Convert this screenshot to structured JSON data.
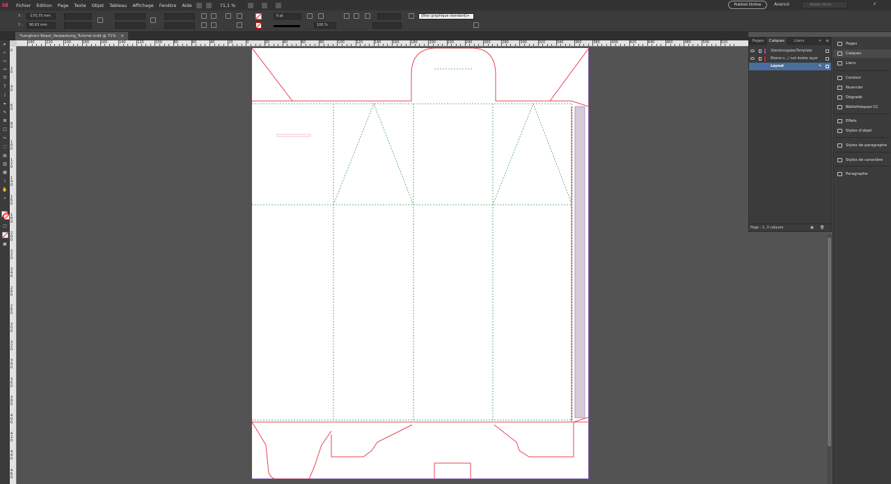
{
  "app": {
    "icon_label": "Id",
    "menu": [
      "Fichier",
      "Edition",
      "Page",
      "Texte",
      "Objet",
      "Tableau",
      "Affichage",
      "Fenêtre",
      "Aide"
    ],
    "zoom": "71,1 %",
    "publish_label": "Publish Online",
    "workspace": "Avancé",
    "search_placeholder": "Adobe Stock"
  },
  "control": {
    "x_label": "X :",
    "x_value": "-170,75 mm",
    "y_label": "Y :",
    "y_value": "90,63 mm",
    "stroke_weight": "0 pt",
    "opacity": "100 %",
    "object_style": "[Bloc graphique standard]+"
  },
  "document_tab": "*Longhorn Roast_Verpackung_Tutorial.indd @ 71%",
  "ruler": {
    "h_labels": [
      "240",
      "220",
      "200",
      "180",
      "160",
      "140",
      "120",
      "100",
      "80",
      "60",
      "40",
      "20",
      "0",
      "20",
      "40",
      "60",
      "80",
      "100",
      "120",
      "140",
      "160",
      "180",
      "200",
      "220",
      "240",
      "260",
      "280",
      "300",
      "320",
      "340",
      "360",
      "380",
      "400",
      "420",
      "440",
      "460",
      "480",
      "500",
      "520"
    ],
    "v_labels": [
      "0",
      "2 0",
      "4 0",
      "6 0",
      "8 0",
      "1 0 0",
      "1 2 0",
      "1 4 0",
      "1 6 0",
      "1 8 0",
      "2 0 0",
      "2 2 0",
      "2 4 0",
      "2 6 0",
      "2 8 0",
      "3 0 0",
      "3 2 0",
      "3 4 0",
      "3 6 0",
      "3 8 0",
      "4 0 0",
      "4 2 0",
      "4 4 0",
      "4 6 0"
    ]
  },
  "layers_panel": {
    "tabs": [
      "Pages",
      "Calques",
      "Liens"
    ],
    "active_tab": "Calques",
    "layers": [
      {
        "name": "Standvorgabe/Template",
        "color": "#b13bd6",
        "selected": false
      },
      {
        "name": "Ebene n.../ not delete layer",
        "color": "#e02020",
        "selected": false
      },
      {
        "name": "Layout",
        "color": "#3a6fd6",
        "selected": true
      }
    ],
    "footer": "Page : 1, 3 calques"
  },
  "dock": {
    "items": [
      {
        "label": "Pages",
        "icon": "pages-icon"
      },
      {
        "label": "Calques",
        "icon": "layers-icon"
      },
      {
        "label": "Liens",
        "icon": "links-icon"
      },
      {
        "label": "Contour",
        "icon": "stroke-icon"
      },
      {
        "label": "Nuancier",
        "icon": "swatches-icon"
      },
      {
        "label": "Dégradé",
        "icon": "gradient-icon"
      },
      {
        "label": "Bibliothèques CC",
        "icon": "cc-libraries-icon"
      },
      {
        "label": "Effets",
        "icon": "effects-icon"
      },
      {
        "label": "Styles d'objet",
        "icon": "object-styles-icon"
      },
      {
        "label": "Styles de paragraphe",
        "icon": "paragraph-styles-icon"
      },
      {
        "label": "Styles de caractère",
        "icon": "character-styles-icon"
      },
      {
        "label": "Paragraphe",
        "icon": "paragraph-icon"
      }
    ]
  },
  "colors": {
    "cut_line": "#e8404f",
    "fold_line": "#3a9a5a",
    "page_frame": "#8e6bb8",
    "glue_flap": "#d5cbd8"
  }
}
